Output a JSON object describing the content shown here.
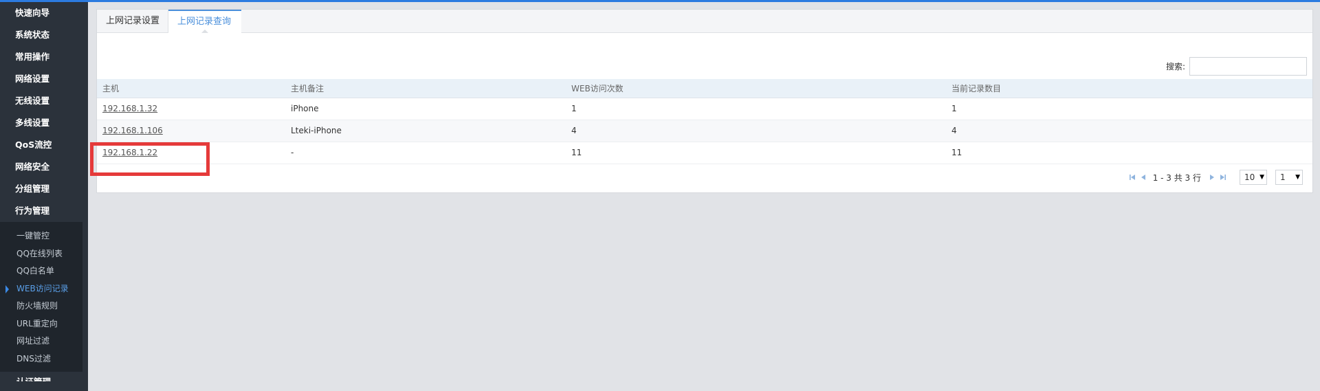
{
  "sidebar": {
    "main_items": [
      "快速向导",
      "系统状态",
      "常用操作",
      "网络设置",
      "无线设置",
      "多线设置",
      "QoS流控",
      "网络安全",
      "分组管理",
      "行为管理"
    ],
    "sub_items": [
      "一键管控",
      "QQ在线列表",
      "QQ白名单",
      "WEB访问记录",
      "防火墙规则",
      "URL重定向",
      "网址过滤",
      "DNS过滤"
    ],
    "active_sub_item": "WEB访问记录",
    "partial_item": "认证管理"
  },
  "tabs": {
    "settings": "上网记录设置",
    "query": "上网记录查询"
  },
  "search": {
    "label": "搜索:",
    "value": ""
  },
  "table": {
    "headers": [
      "主机",
      "主机备注",
      "WEB访问次数",
      "当前记录数目"
    ],
    "rows": [
      {
        "host": "192.168.1.32",
        "note": "iPhone",
        "web_visits": "1",
        "records": "1"
      },
      {
        "host": "192.168.1.106",
        "note": "Lteki-iPhone",
        "web_visits": "4",
        "records": "4"
      },
      {
        "host": "192.168.1.22",
        "note": "-",
        "web_visits": "11",
        "records": "11"
      }
    ]
  },
  "pager": {
    "info": "1 - 3 共 3 行",
    "page_size": "10",
    "page": "1"
  },
  "colors": {
    "accent": "#4a8fdb",
    "sidebar_bg": "#2b323b",
    "highlight": "#e53a3a"
  }
}
